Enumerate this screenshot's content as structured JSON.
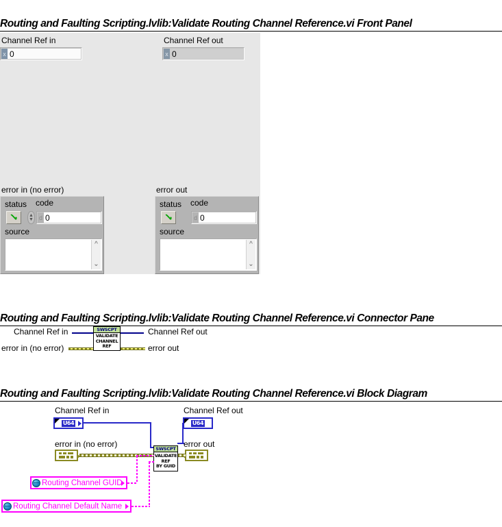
{
  "vi_name": "Routing and Faulting Scripting.lvlib:Validate Routing Channel Reference.vi",
  "sections": {
    "front_panel_title": "Routing and Faulting Scripting.lvlib:Validate Routing Channel Reference.vi Front Panel",
    "connector_pane_title": "Routing and Faulting Scripting.lvlib:Validate Routing Channel Reference.vi Connector Pane",
    "block_diagram_title": "Routing and Faulting Scripting.lvlib:Validate Routing Channel Reference.vi Block Diagram"
  },
  "front_panel": {
    "channel_ref_in": {
      "label": "Channel Ref in",
      "radix": "x",
      "value": "0"
    },
    "channel_ref_out": {
      "label": "Channel Ref out",
      "radix": "x",
      "value": "0"
    },
    "error_in": {
      "label": "error in (no error)",
      "status_label": "status",
      "status_value": "no error",
      "code_label": "code",
      "code_radix": "d",
      "code_value": "0",
      "source_label": "source",
      "source_value": ""
    },
    "error_out": {
      "label": "error out",
      "status_label": "status",
      "status_value": "no error",
      "code_label": "code",
      "code_radix": "d",
      "code_value": "0",
      "source_label": "source",
      "source_value": ""
    }
  },
  "connector_pane": {
    "terminals": {
      "channel_ref_in": "Channel Ref in",
      "channel_ref_out": "Channel Ref out",
      "error_in": "error in (no error)",
      "error_out": "error out"
    },
    "icon": {
      "header": "SWSCPT",
      "line1": "VALIDATE",
      "line2": "CHANNEL",
      "line3": "REF"
    }
  },
  "block_diagram": {
    "labels": {
      "channel_ref_in": "Channel Ref in",
      "channel_ref_out": "Channel Ref out",
      "error_in": "error in (no error)",
      "error_out": "error out"
    },
    "terminals": {
      "channel_ref_in_type": "U64",
      "channel_ref_out_type": "U64"
    },
    "subvi": {
      "header": "SWSCPT",
      "line1": "VALIDATE",
      "line2": "REF",
      "line3": "BY GUID"
    },
    "constants": [
      {
        "text": "Routing Channel GUID",
        "icon": "globe-icon"
      },
      {
        "text": "Routing Channel Default Name",
        "icon": "globe-icon"
      }
    ]
  },
  "colors": {
    "panel_bg": "#e7e7e7",
    "cluster_bg": "#b4b4b4",
    "icon_header_green": "#c0e098",
    "wire_blue": "#2828c8",
    "wire_error": "#8a8a23",
    "constant_magenta": "#ff00ff",
    "led_green": "#00a400"
  }
}
